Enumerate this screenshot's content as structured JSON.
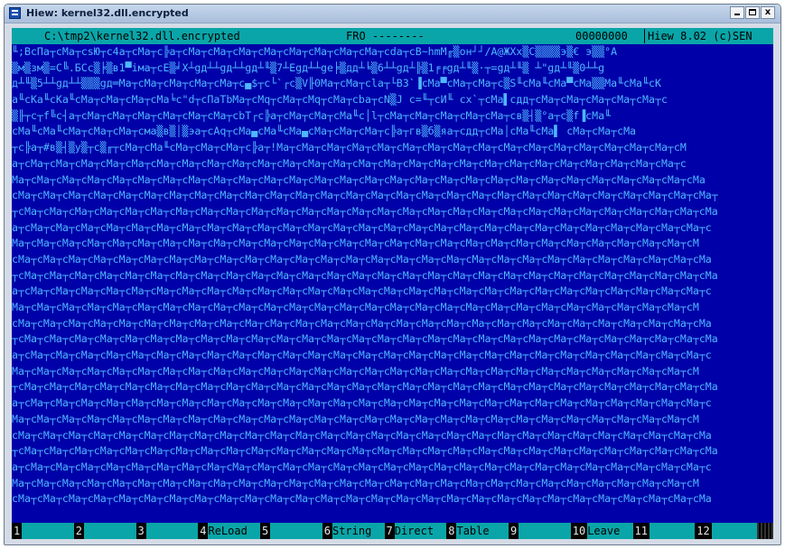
{
  "window": {
    "title": "Hiew: kernel32.dll.encrypted",
    "buttons": [
      "minimize",
      "maximize",
      "close"
    ],
    "close_glyph": "x"
  },
  "status": {
    "path": "C:\\tmp2\\kernel32.dll.encrypted",
    "mode": "FRO --------",
    "offset": "00000000",
    "version": "Hiew 8.02 (c)SEN"
  },
  "hex_lines": [
    "╙;ВсПа┬сМа┬сsЮ┬с4а┬сМа┬с╠а┬сМа┬сМа┬сМа┬сМа┬сМа┬сМа┬сМа┬сМа┬сdа┬сВ~hmМ╓▒он┘┘/А@ЖХх▒С▒▒▒▒э▒€ э▒▒°А",
    "▒м▒зм▒=С╚.БСс▒╞▒в1▀iма┬сЕ▒╛Х┴gд┴┴gд┴┴gд┴╙▒7┴Еgд┴┴gе╞▒дд┴╘▒6┴┴gд┴╠▒1╒╒gд┴╙▒·┬=gд┴╙▒ ┴\"gд┴╙▒0┴┴g",
    "д┴╙▒5┴┴gд┴┴▒▒▒gд═Ма┬сМа┬сМа┬сМа┬сМа┬с▄$┬с└`┌с▒V╟0Ма┬сМа┬сlа┬└В3`▐сМа▀сМа┬сМа┬с▒S╙сМа╙сМа▀сМа▒▒Ма╙сМа╙сК",
    "а╙сКа╙сКа╙сМа┬сМа┬сМа┬сМа╘с\"d┬сПаТbМа┬сМq┬сМа┬сМq┬сМа┬сbа┬сN▒J с=╙┬сИ╙ сх`┬сМа▌сдд┬сМа┬сМа┬сМа┬сМа┬сМа┬с",
    "▒╟┬с┬f╚с┤а┬сМа┬сМа┬сМа┬сМа┬сМа┬сМа┬сbТ┌с╠а┬сМа┬сМа┬сМа╙с│l┬сМа┬сМа┬сМа┬сМа┬сМа┬св▒┤▒°а┬с▒f▐сМа╙",
    "сМа╙сМа╙сМа┬сМа┬сМа┬сма▒в▒│▒эа┬сАq┬сМа▄сМа╙сМа▄сМа┬сМа┬сМа┬с╠а┬гв▒б▒яа┬сдд┬сМа│сМа╙сМа▌ сМа┬сМа┬сМа",
    "┬с╠а┬#в▒┤▒у▒┬с▒╓┬сМа┬сМа╙сМа┬сМа┬сМа┬с╠а┬!Ма┬сМа┬сМа┬сМа┬сМа┬сМа┬сМа┬сМа┬сМа┬сМа┬сМа┬сМа┬сМа┬сМа┬сМа┬сМа┬сМ",
    "а┬сМа┬сМа┬сМа┬сМа┬сМа┬сМа┬сМа┬сМа┬сМа┬сМа┬сМа┬сМа┬сМа┬сМа┬сМа┬сМа┬сМа┬сМа┬сМа┬сМа┬сМа┬сМа┬сМа┬сМа┬сМа┬сМа┬с",
    "Ма┬сМа┬сМа┬сМа┬сМа┬сМа┬сМа┬сМа┬сМа┬сМа┬сМа┬сМа┬сМа┬сМа┬сМа┬сМа┬сМа┬сМа┬сМа┬сМа┬сМа┬сМа┬сМа┬сМа┬сМа┬сМа┬сМа┬сМа",
    "сМа┬сМа┬сМа┬сМа┬сМа┬сМа┬сМа┬сМа┬сМа┬сМа┬сМа┬сМа┬сМа┬сМа┬сМа┬сМа┬сМа┬сМа┬сМа┬сМа┬сМа┬сМа┬сМа┬сМа┬сМа┬сМа┬сМа┬сМа┬",
    "┬сМа┬сМа┬сМа┬сМа┬сМа┬сМа┬сМа┬сМа┬сМа┬сМа┬сМа┬сМа┬сМа┬сМа┬сМа┬сМа┬сМа┬сМа┬сМа┬сМа┬сМа┬сМа┬сМа┬сМа┬сМа┬сМа┬сМа┬сМа",
    "а┬сМа┬сМа┬сМа┬сМа┬сМа┬сМа┬сМа┬сМа┬сМа┬сМа┬сМа┬сМа┬сМа┬сМа┬сМа┬сМа┬сМа┬сМа┬сМа┬сМа┬сМа┬сМа┬сМа┬сМа┬сМа┬сМа┬сМа┬с",
    "Ма┬сМа┬сМа┬сМа┬сМа┬сМа┬сМа┬сМа┬сМа┬сМа┬сМа┬сМа┬сМа┬сМа┬сМа┬сМа┬сМа┬сМа┬сМа┬сМа┬сМа┬сМа┬сМа┬сМа┬сМа┬сМа┬сМа┬сМ",
    "сМа┬сМа┬сМа┬сМа┬сМа┬сМа┬сМа┬сМа┬сМа┬сМа┬сМа┬сМа┬сМа┬сМа┬сМа┬сМа┬сМа┬сМа┬сМа┬сМа┬сМа┬сМа┬сМа┬сМа┬сМа┬сМа┬сМа┬сМа",
    "┬сМа┬сМа┬сМа┬сМа┬сМа┬сМа┬сМа┬сМа┬сМа┬сМа┬сМа┬сМа┬сМа┬сМа┬сМа┬сМа┬сМа┬сМа┬сМа┬сМа┬сМа┬сМа┬сМа┬сМа┬сМа┬сМа┬сМа┬сМа",
    "а┬сМа┬сМа┬сМа┬сМа┬сМа┬сМа┬сМа┬сМа┬сМа┬сМа┬сМа┬сМа┬сМа┬сМа┬сМа┬сМа┬сМа┬сМа┬сМа┬сМа┬сМа┬сМа┬сМа┬сМа┬сМа┬сМа┬сМа┬с",
    "Ма┬сМа┬сМа┬сМа┬сМа┬сМа┬сМа┬сМа┬сМа┬сМа┬сМа┬сМа┬сМа┬сМа┬сМа┬сМа┬сМа┬сМа┬сМа┬сМа┬сМа┬сМа┬сМа┬сМа┬сМа┬сМа┬сМа┬сМ",
    "сМа┬сМа┬сМа┬сМа┬сМа┬сМа┬сМа┬сМа┬сМа┬сМа┬сМа┬сМа┬сМа┬сМа┬сМа┬сМа┬сМа┬сМа┬сМа┬сМа┬сМа┬сМа┬сМа┬сМа┬сМа┬сМа┬сМа┬сМа",
    "┬сМа┬сМа┬сМа┬сМа┬сМа┬сМа┬сМа┬сМа┬сМа┬сМа┬сМа┬сМа┬сМа┬сМа┬сМа┬сМа┬сМа┬сМа┬сМа┬сМа┬сМа┬сМа┬сМа┬сМа┬сМа┬сМа┬сМа┬сМа",
    "а┬сМа┬сМа┬сМа┬сМа┬сМа┬сМа┬сМа┬сМа┬сМа┬сМа┬сМа┬сМа┬сМа┬сМа┬сМа┬сМа┬сМа┬сМа┬сМа┬сМа┬сМа┬сМа┬сМа┬сМа┬сМа┬сМа┬сМа┬с",
    "Ма┬сМа┬сМа┬сМа┬сМа┬сМа┬сМа┬сМа┬сМа┬сМа┬сМа┬сМа┬сМа┬сМа┬сМа┬сМа┬сМа┬сМа┬сМа┬сМа┬сМа┬сМа┬сМа┬сМа┬сМа┬сМа┬сМа┬сМ",
    "┬сМа┬сМа┬сМа┬сМа┬сМа┬сМа┬сМа┬сМа┬сМа┬сМа┬сМа┬сМа┬сМа┬сМа┬сМа┬сМа┬сМа┬сМа┬сМа┬сМа┬сМа┬сМа┬сМа┬сМа┬сМа┬сМа┬сМа┬сМа",
    "а┬сМа┬сМа┬сМа┬сМа┬сМа┬сМа┬сМа┬сМа┬сМа┬сМа┬сМа┬сМа┬сМа┬сМа┬сМа┬сМа┬сМа┬сМа┬сМа┬сМа┬сМа┬сМа┬сМа┬сМа┬сМа┬сМа┬сМа┬с",
    "Ма┬сМа┬сМа┬сМа┬сМа┬сМа┬сМа┬сМа┬сМа┬сМа┬сМа┬сМа┬сМа┬сМа┬сМа┬сМа┬сМа┬сМа┬сМа┬сМа┬сМа┬сМа┬сМа┬сМа┬сМа┬сМа┬сМа┬сМ",
    "сМа┬сМа┬сМа┬сМа┬сМа┬сМа┬сМа┬сМа┬сМа┬сМа┬сМа┬сМа┬сМа┬сМа┬сМа┬сМа┬сМа┬сМа┬сМа┬сМа┬сМа┬сМа┬сМа┬сМа┬сМа┬сМа┬сМа┬сМа",
    "┬сМа┬сМа┬сМа┬сМа┬сМа┬сМа┬сМа┬сМа┬сМа┬сМа┬сМа┬сМа┬сМа┬сМа┬сМа┬сМа┬сМа┬сМа┬сМа┬сМа┬сМа┬сМа┬сМа┬сМа┬сМа┬сМа┬сМа┬сМа",
    "а┬сМа┬сМа┬сМа┬сМа┬сМа┬сМа┬сМа┬сМа┬сМа┬сМа┬сМа┬сМа┬сМа┬сМа┬сМа┬сМа┬сМа┬сМа┬сМа┬сМа┬сМа┬сМа┬сМа┬сМа┬сМа┬сМа┬сМа┬с",
    "Ма┬сМа┬сМа┬сМа┬сМа┬сМа┬сМа┬сМа┬сМа┬сМа┬сМа┬сМа┬сМа┬сМа┬сМа┬сМа┬сМа┬сМа┬сМа┬сМа┬сМа┬сМа┬сМа┬сМа┬сМа┬сМа┬сМа┬сМ",
    "сМа┬сМа┬сМа┬сМа┬сМа┬сМа┬сМа┬сМа┬сМа┬сМа┬сМа┬сМа┬сМа┬сМа┬сМа┬сМа┬сМа┬сМа┬сМа┬сМа┬сМа┬сМа┬сМа┬сМа┬сМа┬сМа┬сМа┬сМа"
  ],
  "fkeys": [
    {
      "num": "1",
      "label": ""
    },
    {
      "num": "2",
      "label": ""
    },
    {
      "num": "3",
      "label": ""
    },
    {
      "num": "4",
      "label": "ReLoad"
    },
    {
      "num": "5",
      "label": ""
    },
    {
      "num": "6",
      "label": "String"
    },
    {
      "num": "7",
      "label": "Direct"
    },
    {
      "num": "8",
      "label": "Table"
    },
    {
      "num": "9",
      "label": ""
    },
    {
      "num": "10",
      "label": "Leave"
    },
    {
      "num": "11",
      "label": ""
    },
    {
      "num": "12",
      "label": ""
    }
  ],
  "colors": {
    "screen_bg": "#0000a8",
    "hex_text": "#4fb7ff",
    "bar_cyan": "#0aa5a8",
    "key_bg": "#000000"
  },
  "icons": {
    "app": "hiew-app-icon",
    "minimize": "minimize-icon",
    "maximize": "maximize-icon",
    "close": "close-icon"
  }
}
